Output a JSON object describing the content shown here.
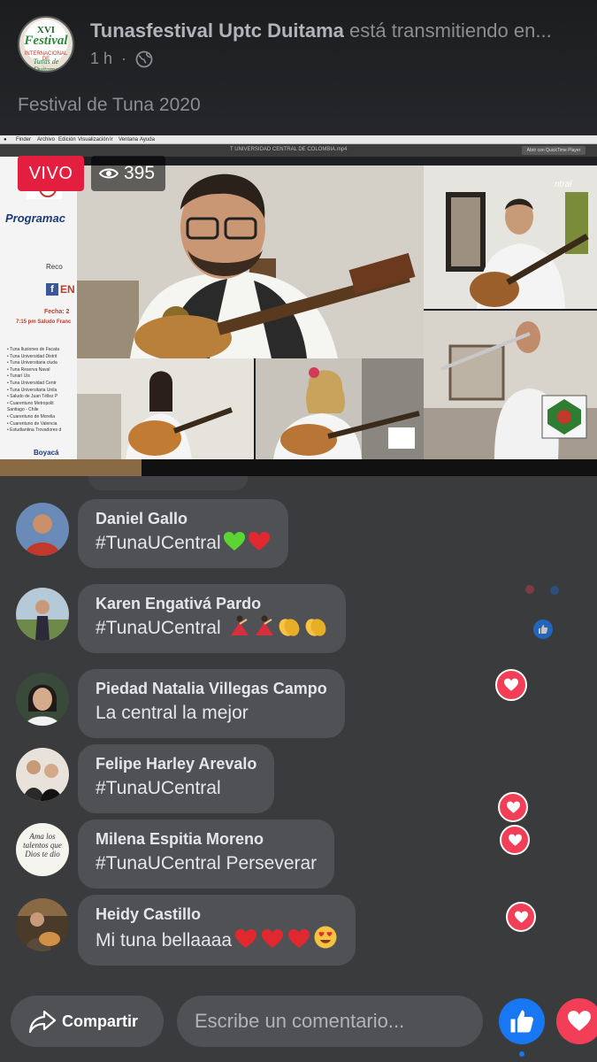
{
  "post": {
    "page_name": "Tunasfestival Uptc Duitama",
    "action": "está transmitiendo en...",
    "time": "1 h",
    "title": "Festival de Tuna 2020",
    "avatar_logo": {
      "line1": "XVI",
      "line2": "Festival",
      "line3": "INTERNACIONAL DE",
      "line4": "Tunas de Duitama"
    }
  },
  "video": {
    "live_label": "VIVO",
    "viewer_count": "395",
    "desktop_menu": [
      "Finder",
      "Archivo",
      "Edición",
      "Visualización",
      "Ir",
      "Ventana",
      "Ayuda"
    ],
    "player_filename": "T UNIVERSIDAD CENTRAL DE COLOMBIA.mp4",
    "player_button": "Abrir con QuickTime Player",
    "program_panel": {
      "title": "Programac",
      "recommendation": "Reco",
      "fb_letter": "f",
      "en_text": "EN",
      "date": "Fecha: 2",
      "greeting": "7:15 pm Saludo Franc",
      "list": [
        "• Tuna Ilusiones de Facata",
        "• Tuna Universidad Distrit",
        "• Tuna Universitaria ciuda",
        "• Tuna Reserva Naval",
        "• Tunarí Uis",
        "• Tuna Universidad Centr",
        "• Tuna Universitaria Unila",
        "• Saludo de Juan Téllez P",
        "• Cuarentuno Metropolit",
        "  Santiago - Chile",
        "• Cuarentuno de Morelia",
        "• Cuarentuno de Valencia",
        "• Estudiantina Trovadores d"
      ],
      "footer": "Boyacá"
    }
  },
  "comments": [
    {
      "name": "Daniel Gallo",
      "text": "#TunaUCentral",
      "emojis": [
        "green-heart",
        "red-heart"
      ]
    },
    {
      "name": "Karen Engativá Pardo",
      "text": "#TunaUCentral ",
      "emojis": [
        "dancer",
        "dancer",
        "clap",
        "clap"
      ]
    },
    {
      "name": "Piedad Natalia Villegas Campo",
      "text": "La central la mejor",
      "emojis": []
    },
    {
      "name": "Felipe Harley Arevalo",
      "text": "#TunaUCentral",
      "emojis": []
    },
    {
      "name": "Milena Espitia Moreno",
      "text": "#TunaUCentral Perseverar",
      "emojis": [],
      "avatar_text": "Ama los talentos que Dios te dio"
    },
    {
      "name": "Heidy Castillo",
      "text": "Mi tuna bellaaaa",
      "emojis": [
        "red-heart",
        "red-heart",
        "red-heart",
        "heart-eyes"
      ]
    }
  ],
  "bottom_bar": {
    "share_label": "Compartir",
    "comment_placeholder": "Escribe un comentario..."
  },
  "colors": {
    "background": "#3a3b3d",
    "bubble": "#505154",
    "live_red": "#e41e3f",
    "like_blue": "#1877f2",
    "love_red": "#f33e58"
  }
}
